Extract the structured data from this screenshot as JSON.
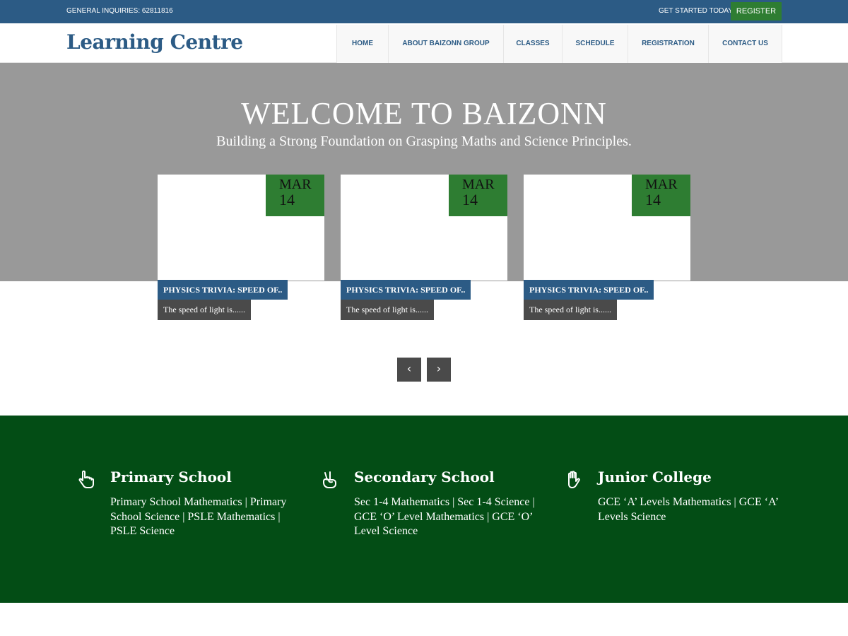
{
  "topbar": {
    "inquiries": "GENERAL INQUIRIES: 62811816",
    "get_started": "GET STARTED TODAY",
    "register": "REGISTER"
  },
  "header": {
    "logo": "Learning Centre",
    "nav": [
      "HOME",
      "ABOUT BAIZONN GROUP",
      "CLASSES",
      "SCHEDULE",
      "REGISTRATION",
      "CONTACT US"
    ]
  },
  "hero": {
    "title": "WELCOME TO BAIZONN",
    "subtitle": "Building a Strong Foundation on Grasping Maths and Science Principles."
  },
  "posts": [
    {
      "month": "MAR",
      "day": "14",
      "title": "PHYSICS TRIVIA: SPEED OF..",
      "excerpt": "The speed of light is......"
    },
    {
      "month": "MAR",
      "day": "14",
      "title": "PHYSICS TRIVIA: SPEED OF..",
      "excerpt": "The speed of light is......"
    },
    {
      "month": "MAR",
      "day": "14",
      "title": "PHYSICS TRIVIA: SPEED OF..",
      "excerpt": "The speed of light is......"
    }
  ],
  "carousel": {
    "prev": "‹",
    "next": "›"
  },
  "levels": [
    {
      "icon": "pointing-hand-icon",
      "title": "Primary School",
      "text": "Primary School Mathematics | Primary School Science | PSLE Mathematics | PSLE Science"
    },
    {
      "icon": "peace-hand-icon",
      "title": "Secondary School",
      "text": "Sec 1-4 Mathematics | Sec 1-4 Science | GCE ‘O’ Level Mathematics | GCE ‘O’ Level Science"
    },
    {
      "icon": "open-hand-icon",
      "title": "Junior College",
      "text": "GCE ‘A’ Levels Mathematics | GCE ‘A’ Levels Science"
    }
  ],
  "colors": {
    "brand_blue": "#2c5b85",
    "brand_green": "#2e7d32",
    "section_green": "#034d15",
    "hero_gray": "#999999"
  }
}
